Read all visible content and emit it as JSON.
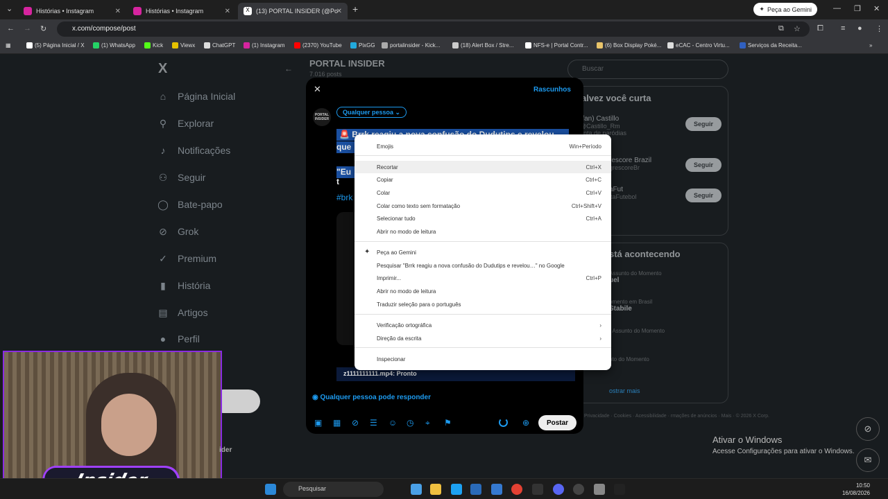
{
  "browser": {
    "tabs": [
      {
        "title": "Histórias • Instagram",
        "color": "#d6249f"
      },
      {
        "title": "Histórias • Instagram",
        "color": "#d6249f"
      },
      {
        "title": "(13) PORTAL INSIDER (@Po",
        "color": "#ffffff"
      }
    ],
    "gemini_label": "Peça ao Gemini",
    "url": "x.com/compose/post",
    "bookmarks": [
      "(5) Página Inicial / X",
      "(1) WhatsApp",
      "Kick",
      "Viewx",
      "ChatGPT",
      "(1) Instagram",
      "(2370) YouTube",
      "PixGG",
      "portalinsider - Kick...",
      "(18) Alert Box / Stre...",
      "NFS-e | Portal Contr...",
      "(6) Box Display Poké...",
      "eCAC - Centro Virtu...",
      "Serviços da Receita..."
    ]
  },
  "sidebar": {
    "logo": "X",
    "items": [
      {
        "label": "Página Inicial",
        "icon": "home-icon",
        "glyph": "⌂"
      },
      {
        "label": "Explorar",
        "icon": "search-icon",
        "glyph": "⚲"
      },
      {
        "label": "Notificações",
        "icon": "bell-icon",
        "glyph": "♪"
      },
      {
        "label": "Seguir",
        "icon": "follow-icon",
        "glyph": "⚇"
      },
      {
        "label": "Bate-papo",
        "icon": "chat-icon",
        "glyph": "◯"
      },
      {
        "label": "Grok",
        "icon": "grok-icon",
        "glyph": "⊘"
      },
      {
        "label": "Premium",
        "icon": "verified-icon",
        "glyph": "✓"
      },
      {
        "label": "História",
        "icon": "bookmark-icon",
        "glyph": "▮"
      },
      {
        "label": "Artigos",
        "icon": "article-icon",
        "glyph": "▤"
      },
      {
        "label": "Perfil",
        "icon": "profile-icon",
        "glyph": "●"
      }
    ]
  },
  "profile": {
    "name": "PORTAL INSIDER",
    "posts": "7.016 posts"
  },
  "compose": {
    "drafts": "Rascunhos",
    "audience": "Qualquer pessoa",
    "avatar_text": "PORTAL INSIDER",
    "line1": "🚨 Brrk reagiu a nova confusão do Dudutips e revelou",
    "line2": "que",
    "line3": "\"Eu t",
    "hashtag": "#brk",
    "upload": "z1111111111.mp4: Pronto",
    "reply_scope": "Qualquer pessoa pode responder",
    "post_button": "Postar"
  },
  "context_menu": {
    "items": [
      {
        "label": "Emojis",
        "shortcut": "Win+Período"
      },
      {
        "label": "Recortar",
        "shortcut": "Ctrl+X"
      },
      {
        "label": "Copiar",
        "shortcut": "Ctrl+C"
      },
      {
        "label": "Colar",
        "shortcut": "Ctrl+V"
      },
      {
        "label": "Colar como texto sem formatação",
        "shortcut": "Ctrl+Shift+V"
      },
      {
        "label": "Selecionar tudo",
        "shortcut": "Ctrl+A"
      },
      {
        "label": "Abrir no modo de leitura",
        "shortcut": ""
      },
      {
        "label": "Peça ao Gemini",
        "shortcut": ""
      },
      {
        "label": "Pesquisar \"Brrk reagiu a nova confusão do Dudutips e revelou…\" no Google",
        "shortcut": ""
      },
      {
        "label": "Imprimir...",
        "shortcut": "Ctrl+P"
      },
      {
        "label": "Abrir no modo de leitura",
        "shortcut": ""
      },
      {
        "label": "Traduzir seleção para o português",
        "shortcut": ""
      },
      {
        "label": "Verificação ortográfica",
        "shortcut": "›"
      },
      {
        "label": "Direção da escrita",
        "shortcut": "›"
      },
      {
        "label": "Inspecionar",
        "shortcut": ""
      }
    ]
  },
  "right": {
    "search_placeholder": "Buscar",
    "suggest_title": "alvez você curta",
    "suggestions": [
      {
        "name": "(fan) Castillo",
        "handle": "@Castillo_Rm",
        "extra": "onta de paródias"
      },
      {
        "name": "rescore Brazil",
        "handle": "grescoreBr",
        "extra": ""
      },
      {
        "name": "aFut",
        "handle": "itaFutebol",
        "extra": ""
      }
    ],
    "follow_label": "Seguir",
    "trends_title": "stá acontecendo",
    "trends": [
      {
        "meta": "Assunto do Momento",
        "name": "uel"
      },
      {
        "meta": "omento em Brasil",
        "name": "Stabile"
      },
      {
        "meta": "- Assunto do Momento",
        "name": ""
      },
      {
        "meta": "nto do Momento",
        "name": ""
      }
    ],
    "show_more": "ostrar mais",
    "footer": "Privacidade · Cookies · Acessibilidade · rmações de anúncios · Mais · © 2026 X Corp."
  },
  "overlay": {
    "logo_text": "Insider",
    "handle": "ider"
  },
  "windows": {
    "activate_title": "Ativar o Windows",
    "activate_sub": "Acesse Configurações para ativar o Windows.",
    "search": "Pesquisar",
    "time": "10:50",
    "date": "16/08/2026"
  }
}
